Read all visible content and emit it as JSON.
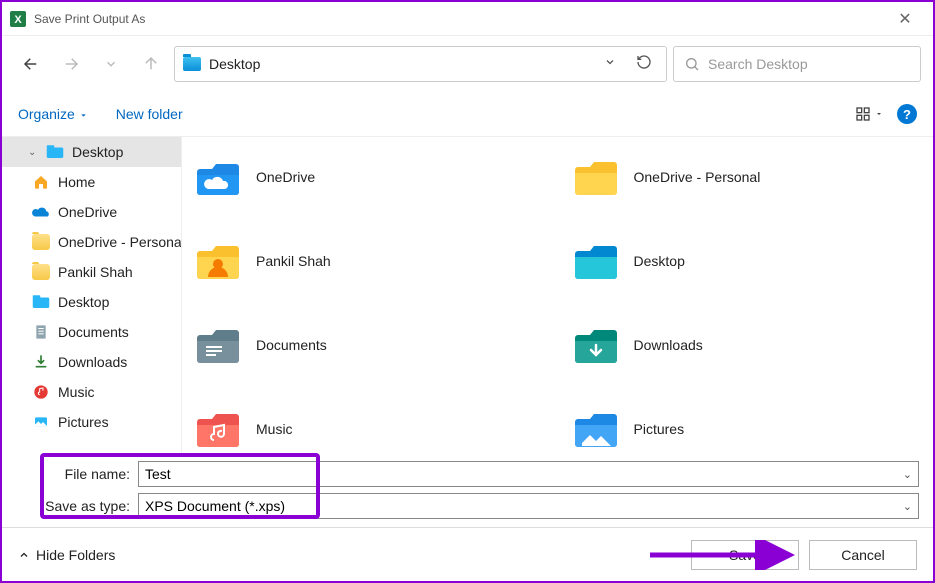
{
  "window": {
    "title": "Save Print Output As"
  },
  "address": {
    "current": "Desktop"
  },
  "search": {
    "placeholder": "Search Desktop"
  },
  "toolbar": {
    "organize": "Organize",
    "new_folder": "New folder"
  },
  "sidebar": {
    "items": [
      {
        "label": "Desktop",
        "icon": "desktop"
      },
      {
        "label": "Home",
        "icon": "home"
      },
      {
        "label": "OneDrive",
        "icon": "onedrive"
      },
      {
        "label": "OneDrive - Personal",
        "icon": "folder-yellow"
      },
      {
        "label": "Pankil Shah",
        "icon": "folder-yellow"
      },
      {
        "label": "Desktop",
        "icon": "desktop2"
      },
      {
        "label": "Documents",
        "icon": "documents"
      },
      {
        "label": "Downloads",
        "icon": "downloads"
      },
      {
        "label": "Music",
        "icon": "music"
      },
      {
        "label": "Pictures",
        "icon": "pictures"
      }
    ]
  },
  "contents": {
    "items": [
      {
        "label": "OneDrive",
        "icon": "onedrive-big"
      },
      {
        "label": "OneDrive - Personal",
        "icon": "folder-yellow-big"
      },
      {
        "label": "Pankil Shah",
        "icon": "folder-user"
      },
      {
        "label": "Desktop",
        "icon": "folder-desktop"
      },
      {
        "label": "Documents",
        "icon": "folder-docs"
      },
      {
        "label": "Downloads",
        "icon": "folder-down"
      },
      {
        "label": "Music",
        "icon": "folder-music"
      },
      {
        "label": "Pictures",
        "icon": "folder-pics"
      }
    ]
  },
  "form": {
    "filename_label": "File name:",
    "filename_value": "Test",
    "saveas_label": "Save as type:",
    "saveas_value": "XPS Document (*.xps)"
  },
  "footer": {
    "hide_folders": "Hide Folders",
    "save": "Save",
    "cancel": "Cancel"
  }
}
